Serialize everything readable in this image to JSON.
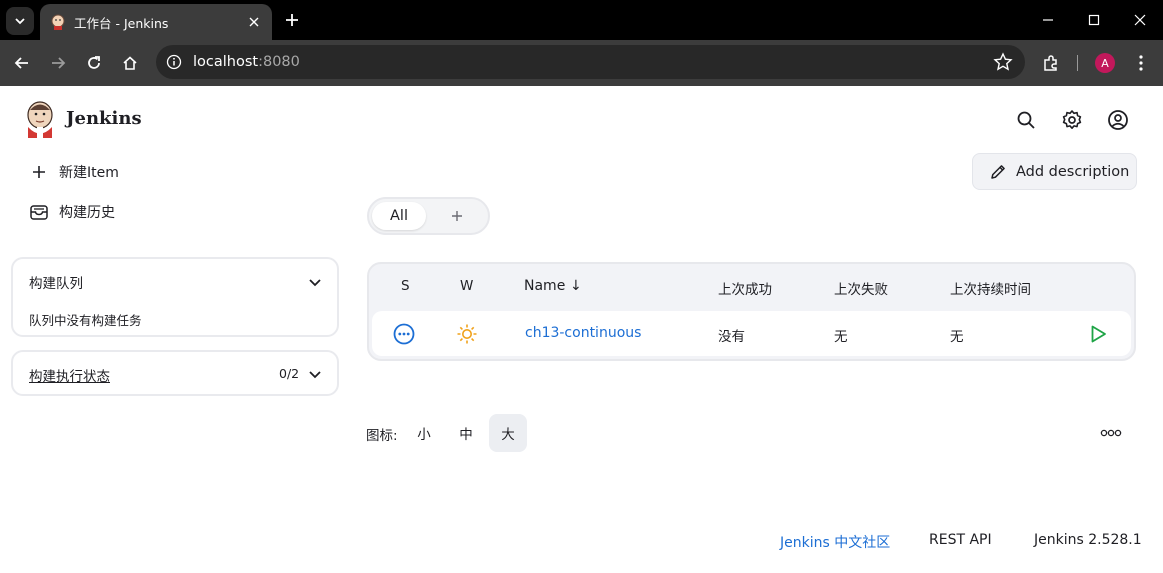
{
  "browser": {
    "tab_title": "工作台 - Jenkins",
    "url_host": "localhost",
    "url_port": ":8080",
    "profile_initial": "A"
  },
  "header": {
    "brand": "Jenkins"
  },
  "sidebar": {
    "new_item": "新建Item",
    "build_history": "构建历史",
    "queue": {
      "title": "构建队列",
      "empty_text": "队列中没有构建任务"
    },
    "executors": {
      "title": "构建执行状态",
      "count": "0/2"
    }
  },
  "main": {
    "add_description": "Add description",
    "views": [
      "All"
    ],
    "table": {
      "headers": {
        "status": "S",
        "weather": "W",
        "name": "Name",
        "name_sort": "↓",
        "last_success": "上次成功",
        "last_failure": "上次失败",
        "last_duration": "上次持续时间"
      },
      "rows": [
        {
          "name": "ch13-continuous",
          "last_success": "没有",
          "last_failure": "无",
          "last_duration": "无",
          "status_icon": "in-progress-icon",
          "weather_icon": "sunny-icon"
        }
      ]
    },
    "icon_size": {
      "label": "图标:",
      "options": [
        "小",
        "中",
        "大"
      ],
      "selected": "大"
    }
  },
  "footer": {
    "community": "Jenkins 中文社区",
    "rest_api": "REST API",
    "version": "Jenkins 2.528.1"
  },
  "colors": {
    "link": "#1c6ed4",
    "status_blue": "#1c6ed4",
    "sun": "#f0a21b",
    "run_green": "#1ea446"
  }
}
